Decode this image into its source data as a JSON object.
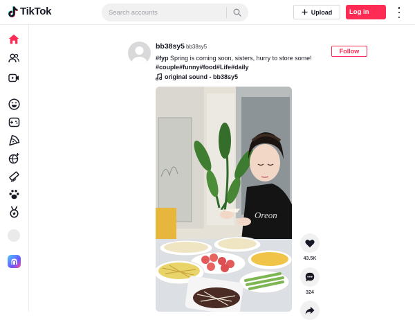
{
  "app": {
    "name": "TikTok"
  },
  "header": {
    "search_placeholder": "Search accounts",
    "upload_label": "Upload",
    "login_label": "Log in"
  },
  "sidebar": {
    "items": [
      {
        "icon": "home-icon",
        "active": true
      },
      {
        "icon": "following-icon"
      },
      {
        "icon": "live-icon"
      },
      {
        "icon": "comedy-icon"
      },
      {
        "icon": "gaming-icon"
      },
      {
        "icon": "food-icon"
      },
      {
        "icon": "sports-icon"
      },
      {
        "icon": "beauty-icon"
      },
      {
        "icon": "animals-icon"
      },
      {
        "icon": "achievement-icon"
      }
    ]
  },
  "post": {
    "username": "bb38sy5",
    "nickname": "bb38sy5",
    "fyp_tag": "#fyp",
    "caption": " Spring is coming soon, sisters, hurry to store some!",
    "hashtags": "#couple#funny#food#Life#daily",
    "sound": "original sound - bb38sy5",
    "follow_label": "Follow",
    "likes": "43.5K",
    "comments": "324"
  },
  "colors": {
    "brand": "#fe2c55",
    "text": "#161823"
  }
}
